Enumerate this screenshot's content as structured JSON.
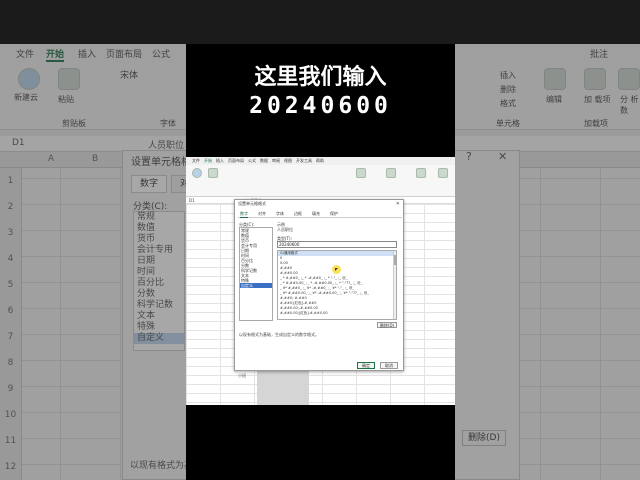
{
  "overlay": {
    "caption_line1": "这里我们输入",
    "caption_line2": "20240600"
  },
  "background": {
    "menu": [
      "文件",
      "开始",
      "插入",
      "页面布局",
      "公式"
    ],
    "menu_active": "开始",
    "right_menu": [
      "批注"
    ],
    "ribbon_labels": {
      "new_cloud": "新建云",
      "paste": "粘贴",
      "clipboard": "剪贴板",
      "font": "字体",
      "insert": "插入",
      "delete": "删除",
      "format": "格式",
      "cells": "单元格",
      "edit": "编辑",
      "addins": "加载项",
      "add_label": "加\n载项",
      "analysis": "分\n析数"
    },
    "font_name": "宋体",
    "cell_ref": "D1",
    "formula_value": "人员职位",
    "columns": [
      "A",
      "B"
    ],
    "rows": [
      "1",
      "2",
      "3",
      "4",
      "5",
      "6",
      "7",
      "8",
      "9",
      "10",
      "11",
      "12"
    ],
    "dialog_title": "设置单元格格式",
    "tab_number": "数字",
    "tab_align": "对齐",
    "category_label": "分类(C):",
    "categories": [
      "常规",
      "数值",
      "货币",
      "会计专用",
      "日期",
      "时间",
      "百分比",
      "分数",
      "科学记数",
      "文本",
      "特殊",
      "自定义"
    ],
    "selected_category": "自定义",
    "help": "?",
    "close": "✕",
    "delete_button": "删除(D)",
    "footer_hint": "以现有格式为基"
  },
  "inner": {
    "menu": [
      "文件",
      "开始",
      "插入",
      "页面布局",
      "公式",
      "数据",
      "审阅",
      "视图",
      "开发工具",
      "帮助"
    ],
    "cell_ref": "D1",
    "formula_value": "人员职位",
    "dialog_title": "设置单元格格式",
    "tabs": [
      "数字",
      "对齐",
      "字体",
      "边框",
      "填充",
      "保护"
    ],
    "active_tab": "数字",
    "category_label": "分类(C):",
    "categories": [
      "常规",
      "数值",
      "货币",
      "会计专用",
      "日期",
      "时间",
      "百分比",
      "分数",
      "科学记数",
      "文本",
      "特殊",
      "自定义"
    ],
    "selected_category": "自定义",
    "sample_label": "示例",
    "sample_value": "人员职位",
    "type_label": "类型(T):",
    "type_value": "20240600",
    "formats": [
      "G/通用格式",
      "0",
      "0.00",
      "#,##0",
      "#,##0.00",
      "_ * #,##0_ ;_ * -#,##0_ ;_ * \"-\"_ ;_ @_",
      "_ * #,##0.00_ ;_ * -#,##0.00_ ;_ * \"-\"??_ ;_ @_",
      "_ ¥* #,##0_ ;_ ¥* -#,##0_ ;_ ¥* \"-\"_ ;_ @_",
      "_ ¥* #,##0.00_ ;_ ¥* -#,##0.00_ ;_ ¥* \"-\"??_ ;_ @_",
      "#,##0;-#,##0",
      "#,##0;[红色]-#,##0",
      "#,##0.00;-#,##0.00",
      "#,##0.00;[红色]-#,##0.00"
    ],
    "delete_button": "删除(D)",
    "hint": "以现有格式为基础，生成自定义的数字格式。",
    "ok_button": "确定",
    "cancel_button": "取消",
    "sheet_tab": "小班"
  }
}
